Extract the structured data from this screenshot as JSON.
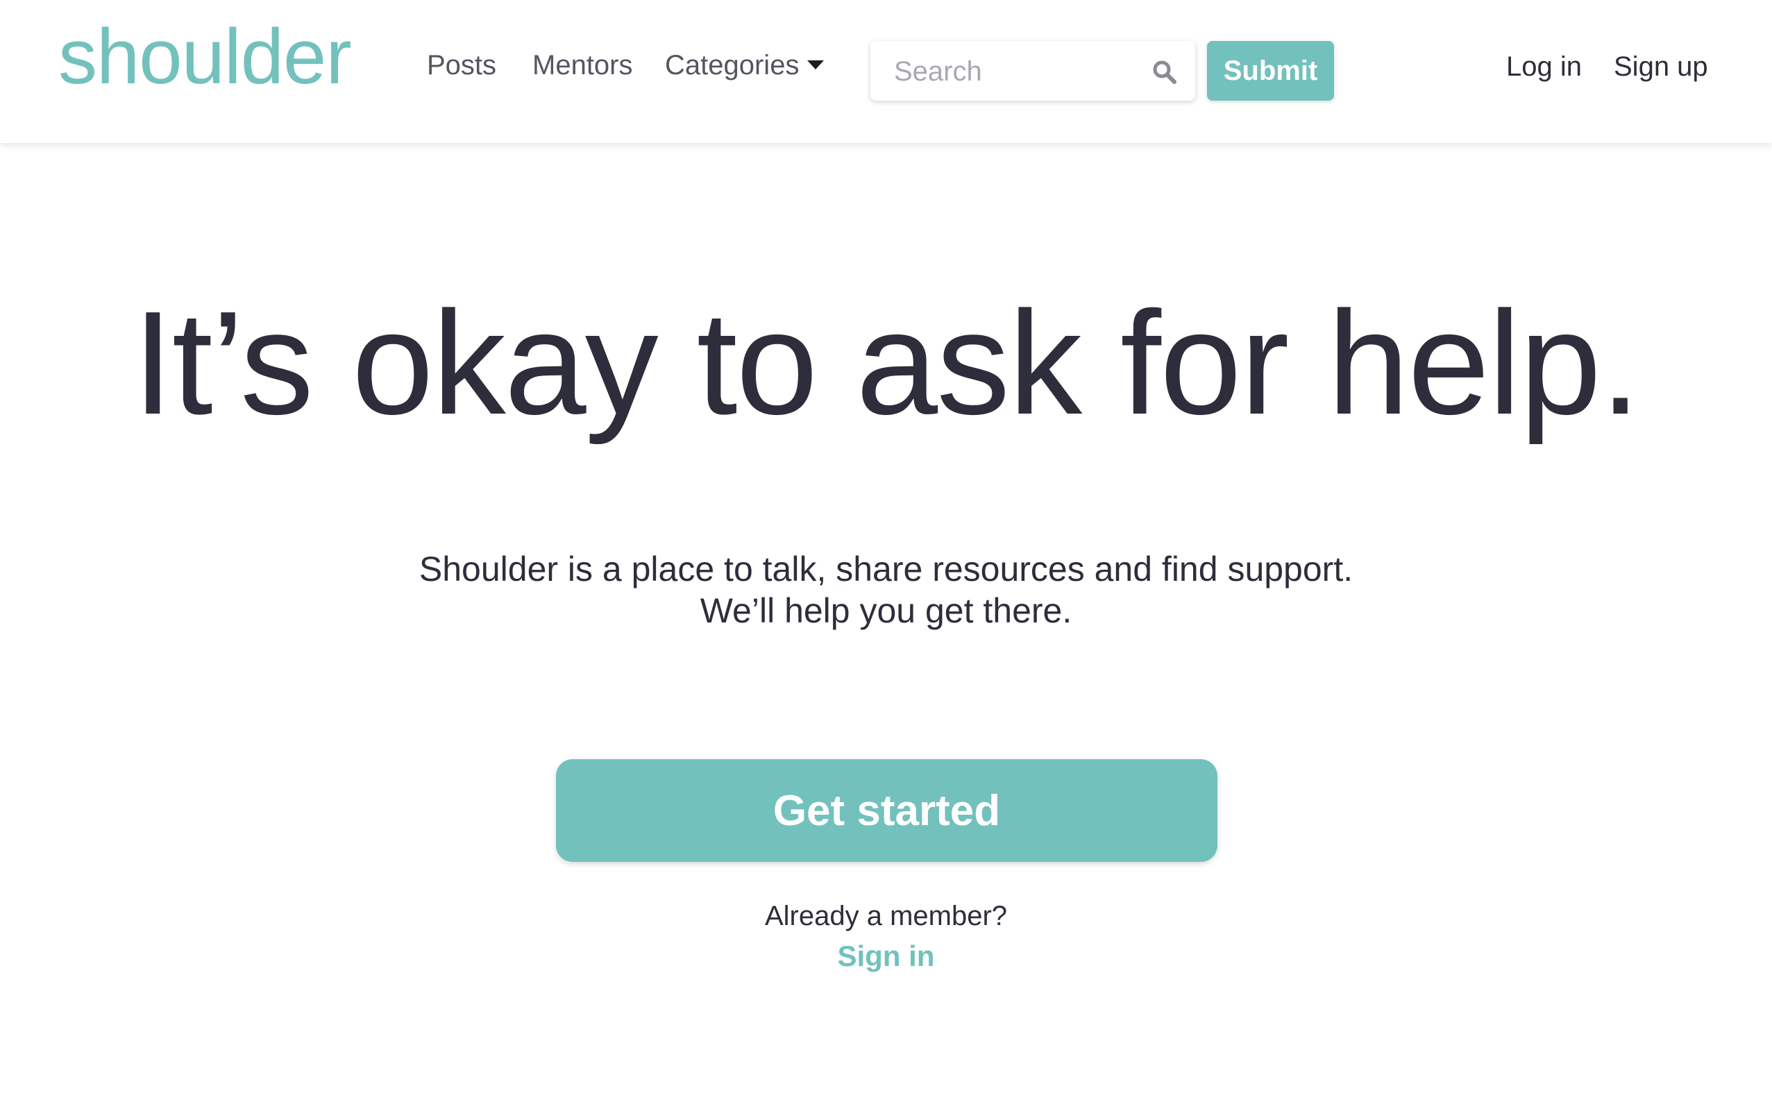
{
  "brand": {
    "logo_text": "shoulder",
    "accent_color": "#72c1bc",
    "text_color": "#2e2d3b"
  },
  "nav": {
    "posts": "Posts",
    "mentors": "Mentors",
    "categories": "Categories"
  },
  "search": {
    "placeholder": "Search",
    "value": "",
    "icon": "search-icon"
  },
  "header_actions": {
    "submit": "Submit",
    "login": "Log in",
    "signup": "Sign up"
  },
  "hero": {
    "title": "It’s okay to ask for help.",
    "subtitle_line1": "Shoulder is a place to talk, share resources and find support.",
    "subtitle_line2": "We’ll help you get there.",
    "cta": "Get started",
    "member_prompt": "Already a member?",
    "signin": "Sign in"
  }
}
